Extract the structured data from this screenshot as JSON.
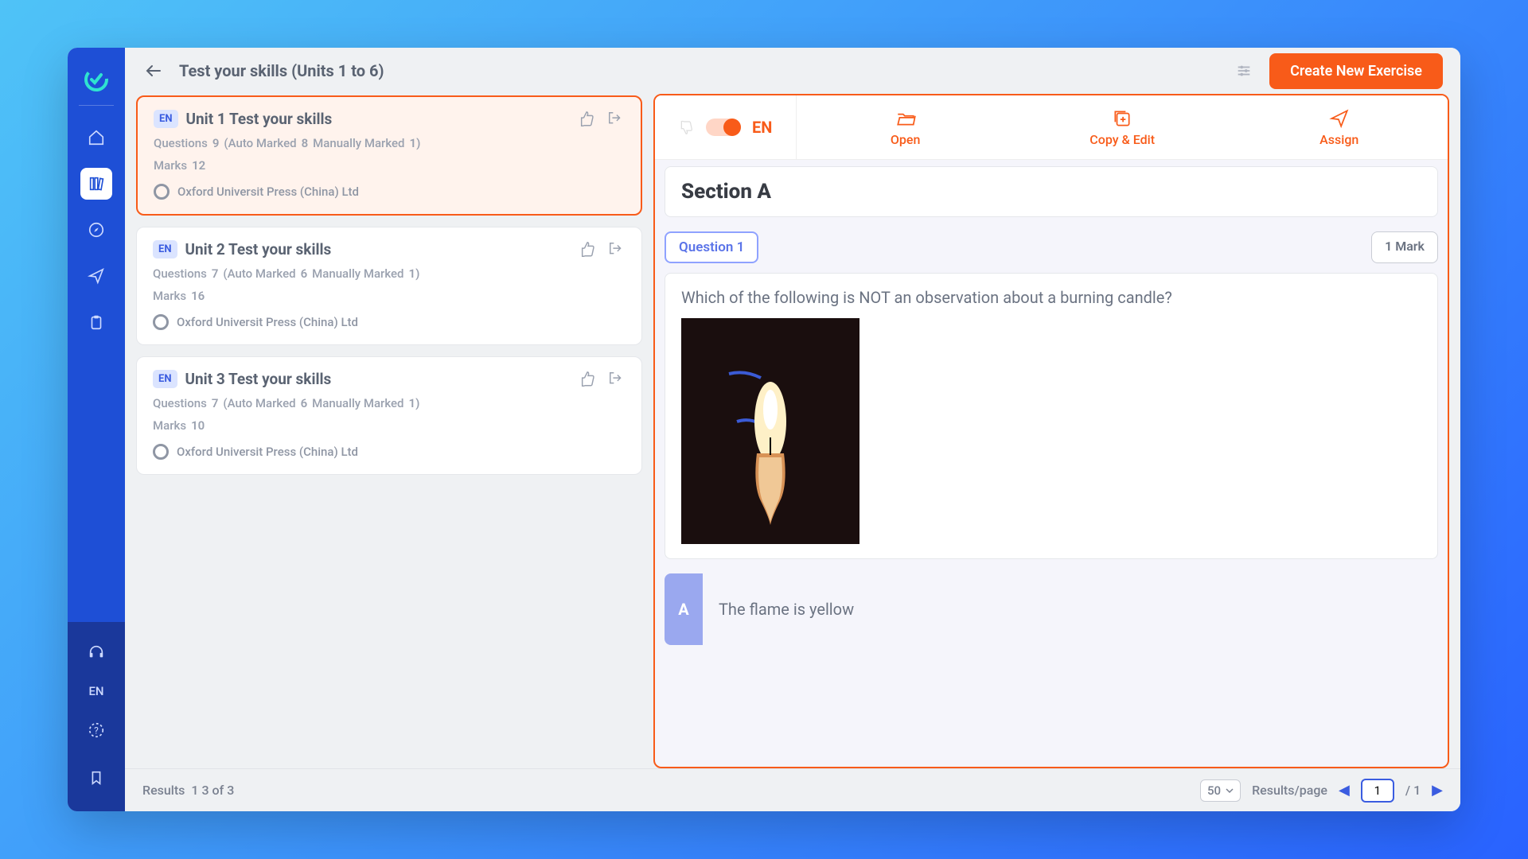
{
  "sidebar": {
    "lang": "EN"
  },
  "header": {
    "title": "Test your skills (Units 1 to 6)",
    "create_btn": "Create New Exercise"
  },
  "exercises": [
    {
      "lang": "EN",
      "title": "Unit 1 Test your skills",
      "questions_label": "Questions",
      "questions": "9",
      "auto_label": "(Auto Marked",
      "auto": "8",
      "manual_label": "Manually Marked",
      "manual": "1)",
      "marks_label": "Marks",
      "marks": "12",
      "publisher": "Oxford Universit  Press (China) Ltd",
      "selected": true
    },
    {
      "lang": "EN",
      "title": "Unit 2 Test your skills",
      "questions_label": "Questions",
      "questions": "7",
      "auto_label": "(Auto Marked",
      "auto": "6",
      "manual_label": "Manually Marked",
      "manual": "1)",
      "marks_label": "Marks",
      "marks": "16",
      "publisher": "Oxford Universit  Press (China) Ltd",
      "selected": false
    },
    {
      "lang": "EN",
      "title": "Unit 3 Test your skills",
      "questions_label": "Questions",
      "questions": "7",
      "auto_label": "(Auto Marked",
      "auto": "6",
      "manual_label": "Manually Marked",
      "manual": "1)",
      "marks_label": "Marks",
      "marks": "10",
      "publisher": "Oxford Universit  Press (China) Ltd",
      "selected": false
    }
  ],
  "preview": {
    "lang": "EN",
    "actions": {
      "open": "Open",
      "copy": "Copy & Edit",
      "assign": "Assign"
    },
    "section": "Section A",
    "question_label": "Question 1",
    "mark_label": "1 Mark",
    "question_text": "Which of the following is NOT an observation about a burning candle?",
    "answer_a": {
      "badge": "A",
      "text": "The flame is yellow"
    }
  },
  "footer": {
    "results_label": "Results",
    "results_range": "1 3 of 3",
    "page_size": "50",
    "results_per_page": "Results/page",
    "page_current": "1",
    "page_sep": "/ 1"
  }
}
